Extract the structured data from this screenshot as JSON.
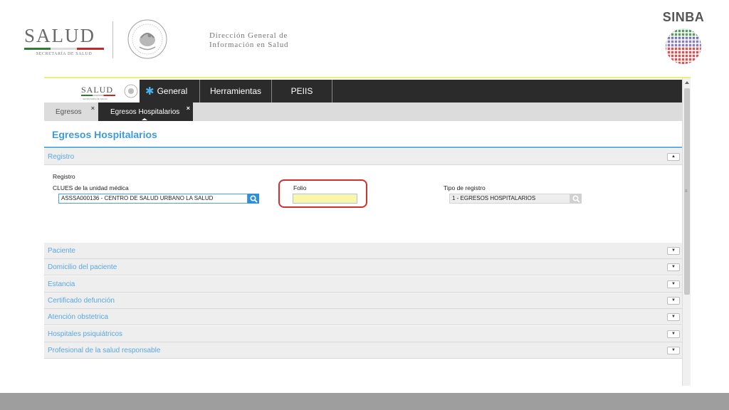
{
  "header": {
    "salud_logo": {
      "word": "SALUD",
      "subtitle": "SECRETARÍA DE SALUD"
    },
    "seal_icon": "mexico-seal-icon",
    "dgis_line1": "Dirección General de",
    "dgis_line2": "Información en Salud",
    "sinba_title": "SINBA",
    "sinba_icon": "sinba-globe-icon"
  },
  "app": {
    "logo_word": "SALUD",
    "logo_sub": "SECRETARÍA DE SALUD",
    "nav": {
      "general": "General",
      "general_icon": "gear-snowflake-icon",
      "herramientas": "Herramientas",
      "peiis": "PEIIS"
    },
    "tabs": [
      {
        "label": "Egresos",
        "close": "×"
      },
      {
        "label": "Egresos Hospitalarios",
        "close": "×"
      }
    ],
    "page_title": "Egresos Hospitalarios",
    "registro_section": {
      "label": "Registro",
      "toggle": "▲",
      "group_label": "Registro",
      "clues_label": "CLUES de la unidad médica",
      "clues_value": "ASSSA000136 - CENTRO DE SALUD URBANO LA SALUD",
      "folio_label": "Folio",
      "folio_value": "",
      "tipo_label": "Tipo de registro",
      "tipo_value": "1 - EGRESOS HOSPITALARIOS"
    },
    "sections": [
      {
        "label": "Paciente",
        "toggle": "▼"
      },
      {
        "label": "Domicilio del paciente",
        "toggle": "▼"
      },
      {
        "label": "Estancia",
        "toggle": "▼"
      },
      {
        "label": "Certificado defunción",
        "toggle": "▼"
      },
      {
        "label": "Atención obstetrica",
        "toggle": "▼"
      },
      {
        "label": "Hospitales psiquiátricos",
        "toggle": "▼"
      },
      {
        "label": "Profesional de la salud responsable",
        "toggle": "▼"
      }
    ],
    "scroll_grip": "≡"
  },
  "colors": {
    "accent_blue": "#3f9bd6",
    "nav_dark": "#2b2b2b",
    "highlight_red": "#d32f2f",
    "folio_yellow": "#fbf6a8"
  }
}
